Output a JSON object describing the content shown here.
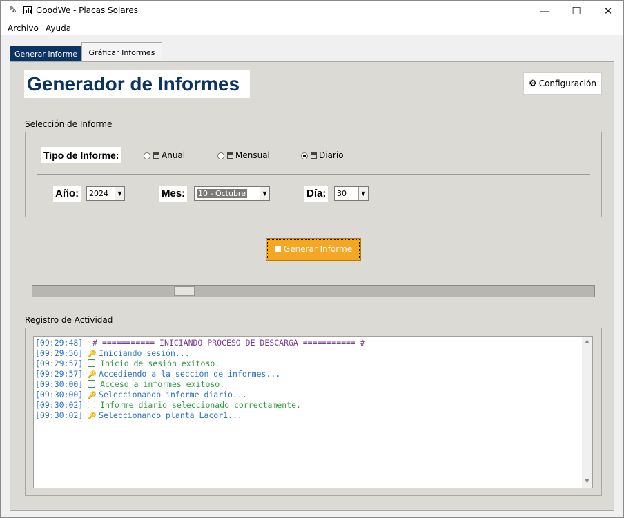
{
  "window": {
    "title": "GoodWe - Placas Solares",
    "minimize_glyph": "—",
    "maximize_glyph": "☐",
    "close_glyph": "✕",
    "feather_icon": "feather-icon"
  },
  "menu": {
    "items": [
      "Archivo",
      "Ayuda"
    ]
  },
  "tabs": [
    {
      "label": "Generar Informe",
      "active": true
    },
    {
      "label": "Gráficar Informes",
      "active": false
    }
  ],
  "header": {
    "title": "Generador de Informes",
    "config_label": "Configuración",
    "config_icon": "gear-icon"
  },
  "selection": {
    "section_label": "Selección de Informe",
    "tipo_label": "Tipo de Informe:",
    "options": [
      {
        "label": "Anual",
        "selected": false
      },
      {
        "label": "Mensual",
        "selected": false
      },
      {
        "label": "Diario",
        "selected": true
      }
    ],
    "year_label": "Año:",
    "year_value": "2024",
    "month_label": "Mes:",
    "month_value": "10 - Octubre",
    "day_label": "Día:",
    "day_value": "30"
  },
  "actions": {
    "generate_label": "Generar Informe"
  },
  "log": {
    "section_label": "Registro de Actividad",
    "lines": [
      {
        "time": "[09:29:48]",
        "text": "  # =========== INICIANDO PROCESO DE DESCARGA =========== #",
        "kind": "title"
      },
      {
        "time": "[09:29:56]",
        "text": "Iniciando sesión...",
        "kind": "info"
      },
      {
        "time": "[09:29:57]",
        "text": "Inicio de sesión exitoso.",
        "kind": "ok"
      },
      {
        "time": "[09:29:57]",
        "text": "Accediendo a la sección de informes...",
        "kind": "info"
      },
      {
        "time": "[09:30:00]",
        "text": "Acceso a informes exitoso.",
        "kind": "ok"
      },
      {
        "time": "[09:30:00]",
        "text": "Seleccionando informe diario...",
        "kind": "info"
      },
      {
        "time": "[09:30:02]",
        "text": "Informe diario seleccionado correctamente.",
        "kind": "ok"
      },
      {
        "time": "[09:30:02]",
        "text": "Seleccionando planta Lacor1...",
        "kind": "info"
      }
    ]
  },
  "colors": {
    "accent": "#0c3463",
    "button_orange": "#f5a623",
    "log_timestamp": "#2b72c4",
    "log_title": "#7b3a96",
    "log_ok": "#2e9c3e"
  }
}
